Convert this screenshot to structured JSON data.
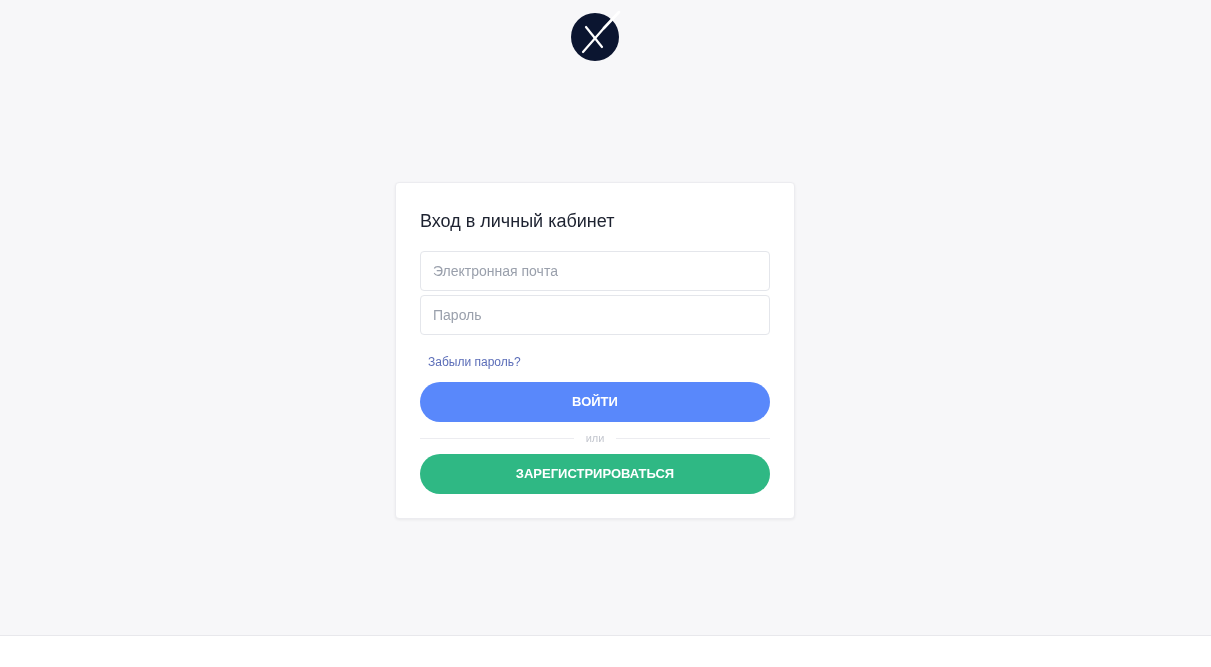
{
  "login_card": {
    "title": "Вход в личный кабинет",
    "fields": [
      {
        "placeholder": "Электронная почта"
      },
      {
        "placeholder": "Пароль"
      }
    ],
    "forgot_link": "Забыли пароль?",
    "login_button": "ВОЙТИ",
    "divider": "или",
    "register_button": "ЗАРЕГИСТРИРОВАТЬСЯ"
  }
}
